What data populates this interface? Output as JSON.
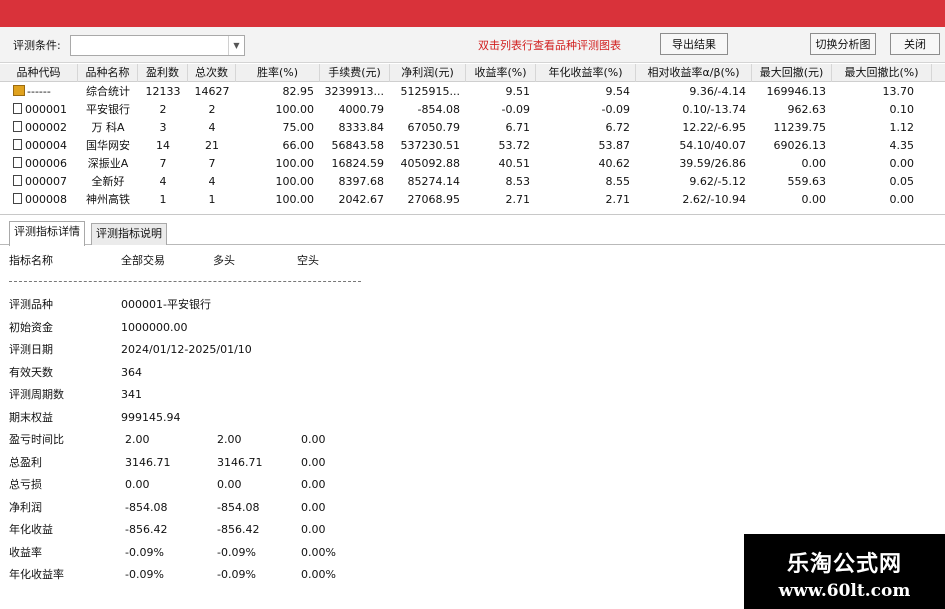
{
  "toolbar": {
    "condition_label": "评测条件:",
    "condition_value": "",
    "hint": "双击列表行查看品种评测图表",
    "export_label": "导出结果",
    "switch_label": "切换分析图",
    "close_label": "关闭"
  },
  "table": {
    "columns": [
      "品种代码",
      "品种名称",
      "盈利数",
      "总次数",
      "胜率(%)",
      "手续费(元)",
      "净利润(元)",
      "收益率(%)",
      "年化收益率(%)",
      "相对收益率α/β(%)",
      "最大回撤(元)",
      "最大回撤比(%)"
    ],
    "rows": [
      [
        "------",
        "综合统计",
        "12133",
        "14627",
        "82.95",
        "3239913...",
        "5125915...",
        "9.51",
        "9.54",
        "9.36/-4.14",
        "169946.13",
        "13.70"
      ],
      [
        "000001",
        "平安银行",
        "2",
        "2",
        "100.00",
        "4000.79",
        "-854.08",
        "-0.09",
        "-0.09",
        "0.10/-13.74",
        "962.63",
        "0.10"
      ],
      [
        "000002",
        "万 科A",
        "3",
        "4",
        "75.00",
        "8333.84",
        "67050.79",
        "6.71",
        "6.72",
        "12.22/-6.95",
        "11239.75",
        "1.12"
      ],
      [
        "000004",
        "国华网安",
        "14",
        "21",
        "66.00",
        "56843.58",
        "537230.51",
        "53.72",
        "53.87",
        "54.10/40.07",
        "69026.13",
        "4.35"
      ],
      [
        "000006",
        "深振业A",
        "7",
        "7",
        "100.00",
        "16824.59",
        "405092.88",
        "40.51",
        "40.62",
        "39.59/26.86",
        "0.00",
        "0.00"
      ],
      [
        "000007",
        "全新好",
        "4",
        "4",
        "100.00",
        "8397.68",
        "85274.14",
        "8.53",
        "8.55",
        "9.62/-5.12",
        "559.63",
        "0.05"
      ],
      [
        "000008",
        "神州高铁",
        "1",
        "1",
        "100.00",
        "2042.67",
        "27068.95",
        "2.71",
        "2.71",
        "2.62/-10.94",
        "0.00",
        "0.00"
      ]
    ]
  },
  "tabs": [
    "评测指标详情",
    "评测指标说明"
  ],
  "detail": {
    "headers": [
      "指标名称",
      "全部交易",
      "多头",
      "空头"
    ],
    "rows": [
      [
        "评测品种",
        "000001-平安银行",
        "",
        ""
      ],
      [
        "初始资金",
        "1000000.00",
        "",
        ""
      ],
      [
        "评测日期",
        "2024/01/12-2025/01/10",
        "",
        ""
      ],
      [
        "有效天数",
        "364",
        "",
        ""
      ],
      [
        "评测周期数",
        "341",
        "",
        ""
      ],
      [
        "期末权益",
        "999145.94",
        "",
        ""
      ],
      [
        "盈亏时间比",
        "2.00",
        "2.00",
        "0.00"
      ],
      [
        "总盈利",
        "3146.71",
        "3146.71",
        "0.00"
      ],
      [
        "总亏损",
        "0.00",
        "0.00",
        "0.00"
      ],
      [
        "净利润",
        "-854.08",
        "-854.08",
        "0.00"
      ],
      [
        "年化收益",
        "-856.42",
        "-856.42",
        "0.00"
      ],
      [
        "收益率",
        "-0.09%",
        "-0.09%",
        "0.00%"
      ],
      [
        "年化收益率",
        "-0.09%",
        "-0.09%",
        "0.00%"
      ]
    ]
  },
  "watermark": {
    "title": "乐淘公式网",
    "url": "www.60lt.com"
  },
  "colors": {
    "titlebar": "#d9323a",
    "hint": "#d22020"
  }
}
